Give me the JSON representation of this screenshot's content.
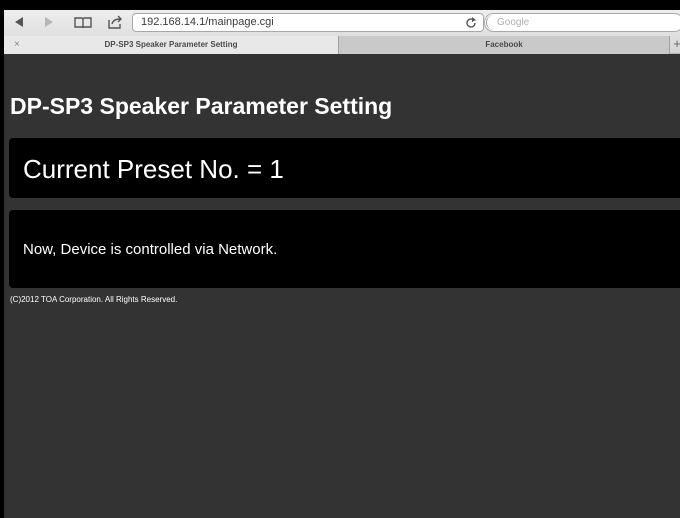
{
  "browser": {
    "url": "192.168.14.1/mainpage.cgi",
    "search_placeholder": "Google",
    "tabs": [
      {
        "label": "DP-SP3 Speaker Parameter Setting",
        "active": true
      },
      {
        "label": "Facebook",
        "active": false
      }
    ],
    "close_tab_glyph": "×",
    "new_tab_glyph": "+"
  },
  "page": {
    "title": "DP-SP3 Speaker Parameter Setting",
    "preset_text": "Current Preset No. = 1",
    "status_text": "Now, Device is controlled via Network.",
    "copyright": "(C)2012 TOA Corporation. All Rights Reserved."
  },
  "colors": {
    "page_background": "#333333",
    "panel_background": "#000000",
    "text": "#ffffff"
  }
}
